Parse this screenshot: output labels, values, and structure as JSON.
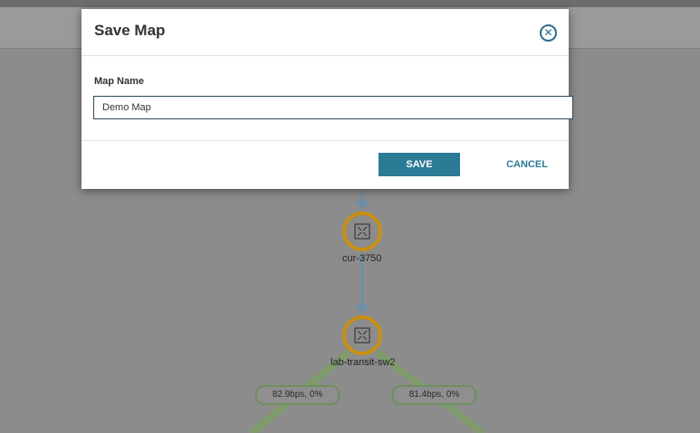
{
  "map": {
    "nodes": [
      {
        "name": "cur-3750",
        "icon": "switch-icon"
      },
      {
        "name": "lab-transit-sw2",
        "icon": "switch-icon"
      }
    ],
    "links": [
      {
        "label": "82.9bps,  0%"
      },
      {
        "label": "81.4bps,  0%"
      }
    ]
  },
  "dialog": {
    "title": "Save Map",
    "field_label": "Map Name",
    "field_value": "Demo Map",
    "save_label": "SAVE",
    "cancel_label": "CANCEL",
    "close_icon": "close-circle-icon"
  },
  "colors": {
    "accent": "#2b7a96",
    "node_ring": "#d19a10",
    "link_line": "#7f9fb5",
    "link_green": "#8fb07a",
    "overlay": "#8c8c8c"
  }
}
